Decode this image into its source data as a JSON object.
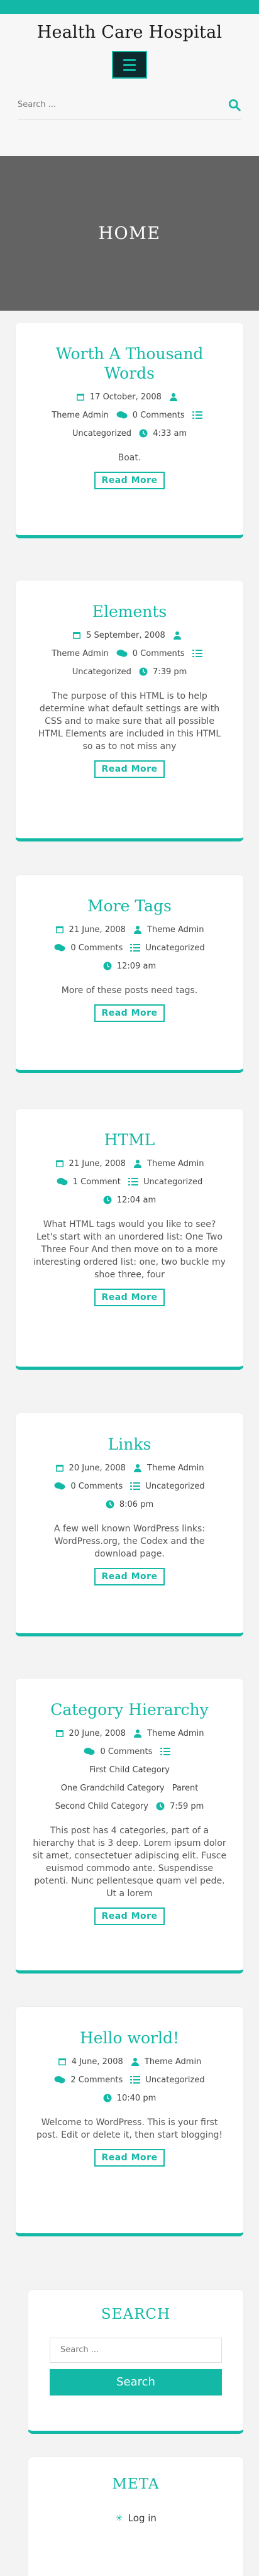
{
  "site": {
    "title": "Health Care Hospital"
  },
  "search_top": {
    "placeholder": "Search ..."
  },
  "hero": {
    "title": "HOME"
  },
  "posts": [
    {
      "title": "Worth A Thousand Words",
      "date": "17 October, 2008",
      "author": "Theme Admin",
      "comments": "0 Comments",
      "category": "Uncategorized",
      "time": "4:33 am",
      "excerpt": "Boat.",
      "read_more": "Read More"
    },
    {
      "title": "Elements",
      "date": "5 September, 2008",
      "author": "Theme Admin",
      "comments": "0 Comments",
      "category": "Uncategorized",
      "time": "7:39 pm",
      "excerpt": "The purpose of this HTML is to help determine what default settings are with CSS and to make sure that all possible HTML Elements are included in this HTML so as to not miss any",
      "read_more": "Read More"
    },
    {
      "title": "More Tags",
      "date": "21 June, 2008",
      "author": "Theme Admin",
      "comments": "0 Comments",
      "category": "Uncategorized",
      "time": "12:09 am",
      "excerpt": "More of these posts need tags.",
      "read_more": "Read More"
    },
    {
      "title": "HTML",
      "date": "21 June, 2008",
      "author": "Theme Admin",
      "comments": "1 Comment",
      "category": "Uncategorized",
      "time": "12:04 am",
      "excerpt": "What HTML tags would you like to see? Let's start with an unordered list: One Two Three Four And then move on to a more interesting ordered list: one, two buckle my shoe three, four",
      "read_more": "Read More"
    },
    {
      "title": "Links",
      "date": "20 June, 2008",
      "author": "Theme Admin",
      "comments": "0 Comments",
      "category": "Uncategorized",
      "time": "8:06 pm",
      "excerpt": "A few well known WordPress links: WordPress.org, the Codex and the download page.",
      "read_more": "Read More"
    },
    {
      "title": "Category Hierarchy",
      "date": "20 June, 2008",
      "author": "Theme Admin",
      "comments": "0 Comments",
      "categories": [
        "First Child Category",
        "One Grandchild Category",
        "Parent",
        "Second Child Category"
      ],
      "time": "7:59 pm",
      "excerpt": "This post has 4 categories, part of a hierarchy that is 3 deep. Lorem ipsum dolor sit amet, consectetuer adipiscing elit. Fusce euismod commodo ante. Suspendisse potenti. Nunc pellentesque quam vel pede. Ut a lorem",
      "read_more": "Read More"
    },
    {
      "title": "Hello world!",
      "date": "4 June, 2008",
      "author": "Theme Admin",
      "comments": "2 Comments",
      "category": "Uncategorized",
      "time": "10:40 pm",
      "excerpt": "Welcome to WordPress. This is your first post. Edit or delete it, then start blogging!",
      "read_more": "Read More"
    }
  ],
  "widgets": {
    "search": {
      "title": "SEARCH",
      "placeholder": "Search ...",
      "button": "Search"
    },
    "meta": {
      "title": "META",
      "login": "Log in"
    }
  },
  "colors": {
    "accent": "#14b8a6",
    "hero_bg": "#636363",
    "menu_bg": "#0d2a2e"
  }
}
